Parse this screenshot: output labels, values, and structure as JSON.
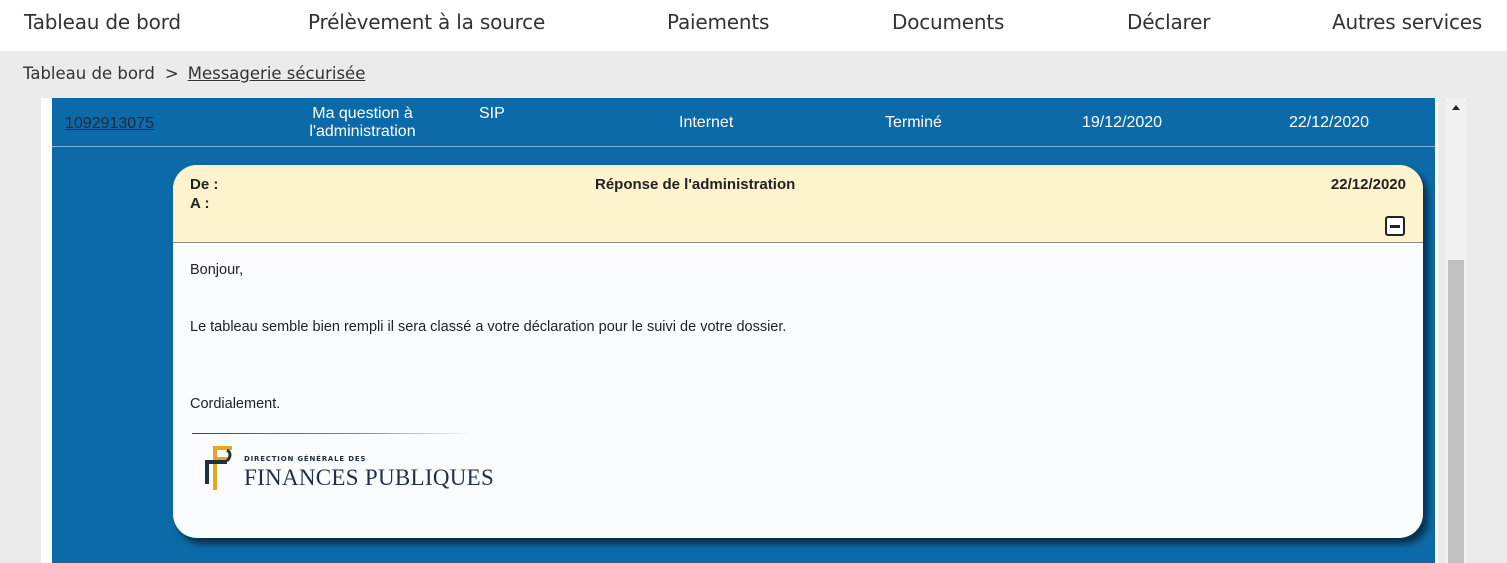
{
  "nav": {
    "items": [
      {
        "label": "Tableau de bord"
      },
      {
        "label": "Prélèvement à la source"
      },
      {
        "label": "Paiements"
      },
      {
        "label": "Documents"
      },
      {
        "label": "Déclarer"
      },
      {
        "label": "Autres services"
      }
    ]
  },
  "breadcrumb": {
    "home": "Tableau de bord",
    "separator": ">",
    "current": "Messagerie sécurisée"
  },
  "message_row": {
    "reference": "1092913075",
    "subject_line1": "Ma question à",
    "subject_line2": "l'administration",
    "service": "SIP",
    "channel": "Internet",
    "status": "Terminé",
    "created": "19/12/2020",
    "updated": "22/12/2020"
  },
  "reply": {
    "from_label": "De :",
    "to_label": "A :",
    "title": "Réponse de l'administration",
    "date": "22/12/2020",
    "body": {
      "greeting": "Bonjour,",
      "text": "Le tableau semble bien rempli il sera classé a votre déclaration pour le suivi de votre dossier.",
      "closing": "Cordialement."
    },
    "signature": {
      "logo_small": "DIRECTION GÉNÉRALE DES",
      "logo_big": "FINANCES PUBLIQUES"
    }
  },
  "colors": {
    "blue_panel": "#0d6aa8",
    "header_cream": "#fdf3cd",
    "logo_gold": "#e8a51b",
    "logo_navy": "#1f2f4a"
  },
  "icons": {
    "collapse": "minus-square-icon",
    "scroll_up": "triangle-up-icon",
    "logo": "dgfip-logo"
  }
}
